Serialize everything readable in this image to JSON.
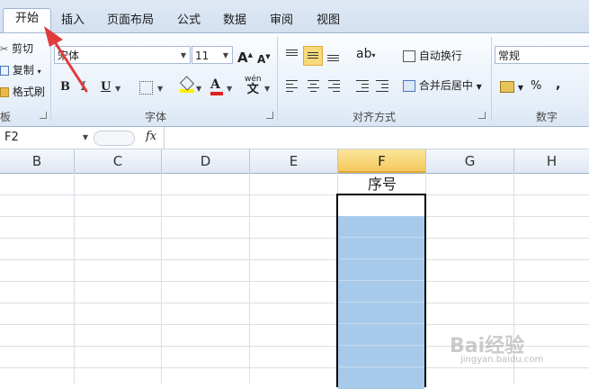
{
  "tabs": [
    {
      "label": "开始",
      "active": true
    },
    {
      "label": "插入"
    },
    {
      "label": "页面布局"
    },
    {
      "label": "公式"
    },
    {
      "label": "数据"
    },
    {
      "label": "审阅"
    },
    {
      "label": "视图"
    }
  ],
  "clipboard": {
    "cut": "剪切",
    "copy": "复制",
    "format_painter": "格式刷",
    "group_label": "板"
  },
  "font": {
    "name": "宋体",
    "size": "11",
    "bold": "B",
    "italic": "I",
    "underline": "U",
    "grow": "A",
    "shrink": "A",
    "color_letter": "A",
    "phonetic": "wén",
    "phonetic_char": "文",
    "group_label": "字体"
  },
  "alignment": {
    "wrap_text": "自动换行",
    "merge_center": "合并后居中",
    "group_label": "对齐方式"
  },
  "number": {
    "format": "常规",
    "percent": "%",
    "comma": ",",
    "group_label": "数字"
  },
  "formula_bar": {
    "name_box": "F2",
    "fx": "fx",
    "value": ""
  },
  "columns": [
    "B",
    "C",
    "D",
    "E",
    "F",
    "G",
    "H"
  ],
  "selected_column": "F",
  "cells": {
    "F1": "序号"
  },
  "colors": {
    "selection_fill": "#a8caea",
    "highlight": "#f8d979",
    "font_color_bar": "#e02020",
    "fill_color_bar": "#ffef00",
    "arrow": "#e23b3b"
  },
  "watermark": {
    "brand": "Bai经验",
    "url": "jingyan.baidu.com"
  }
}
